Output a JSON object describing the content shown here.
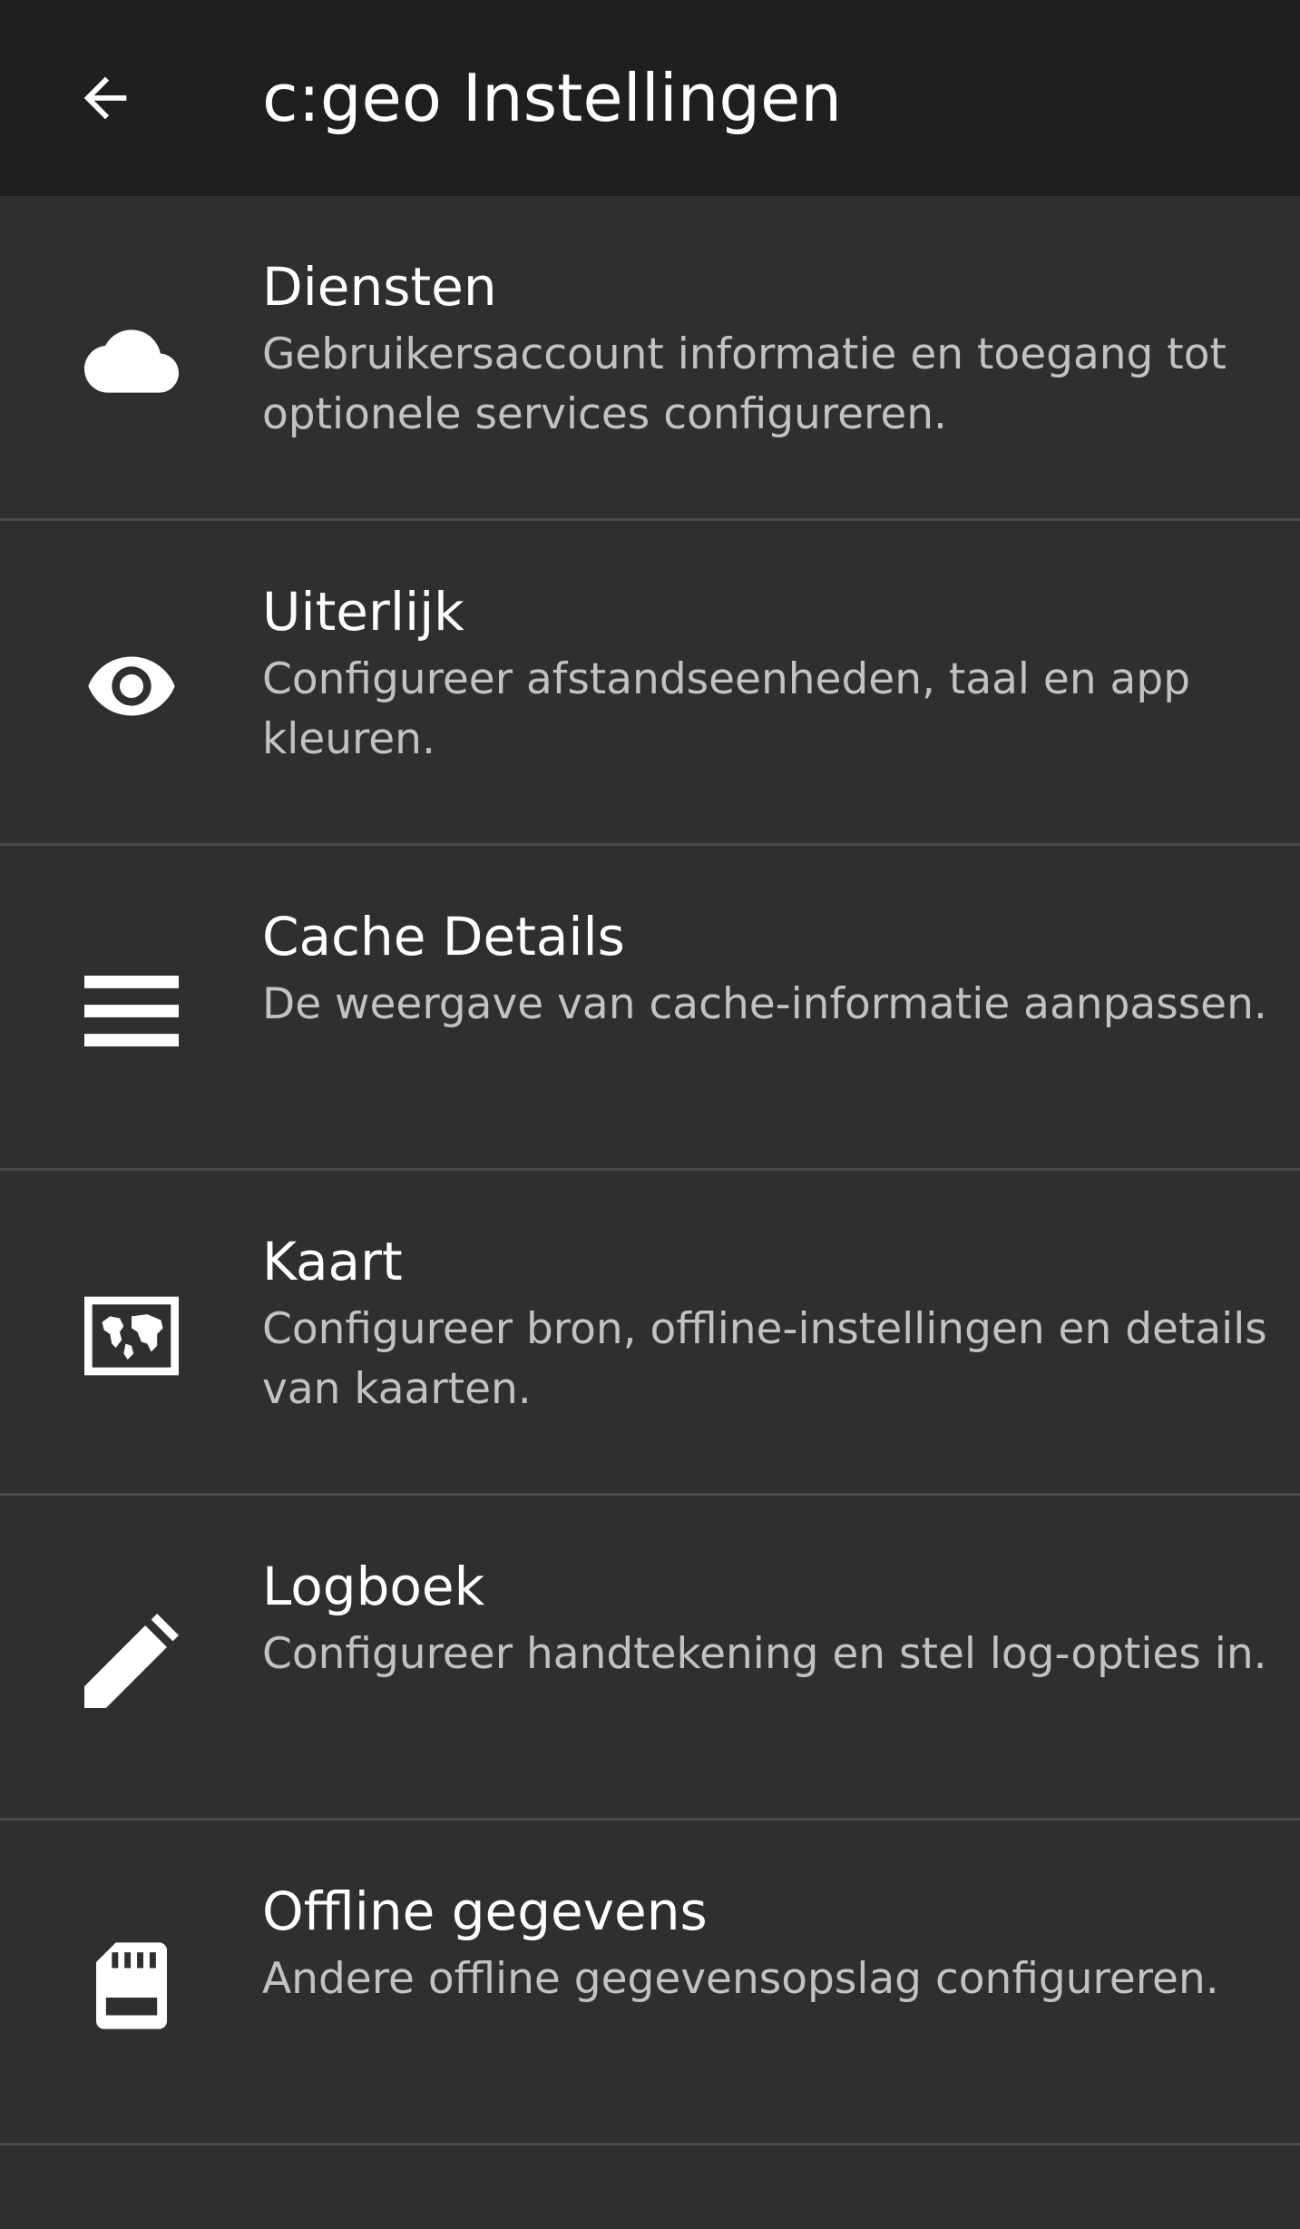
{
  "appbar": {
    "title": "c:geo Instellingen",
    "back_icon": "arrow-back-icon"
  },
  "colors": {
    "appbar_bg": "#1f1f1f",
    "list_bg": "#2f2f2f",
    "divider": "#4a4a4a",
    "primary_text": "#ffffff",
    "secondary_text": "#c2c2c2"
  },
  "settings": {
    "items": [
      {
        "label": "Diensten",
        "description": "Gebruikersaccount informatie en toegang tot optionele services configureren.",
        "icon": "cloud-icon"
      },
      {
        "label": "Uiterlijk",
        "description": "Configureer afstandseenheden, taal en app kleuren.",
        "icon": "eye-icon"
      },
      {
        "label": "Cache Details",
        "description": "De weergave van cache-informatie aanpassen.",
        "icon": "list-icon"
      },
      {
        "label": "Kaart",
        "description": "Configureer bron, offline-instellingen en details van kaarten.",
        "icon": "map-icon"
      },
      {
        "label": "Logboek",
        "description": "Configureer handtekening en stel log-opties in.",
        "icon": "pencil-icon"
      },
      {
        "label": "Offline gegevens",
        "description": "Andere offline gegevensopslag configureren.",
        "icon": "sd-card-icon"
      }
    ]
  }
}
